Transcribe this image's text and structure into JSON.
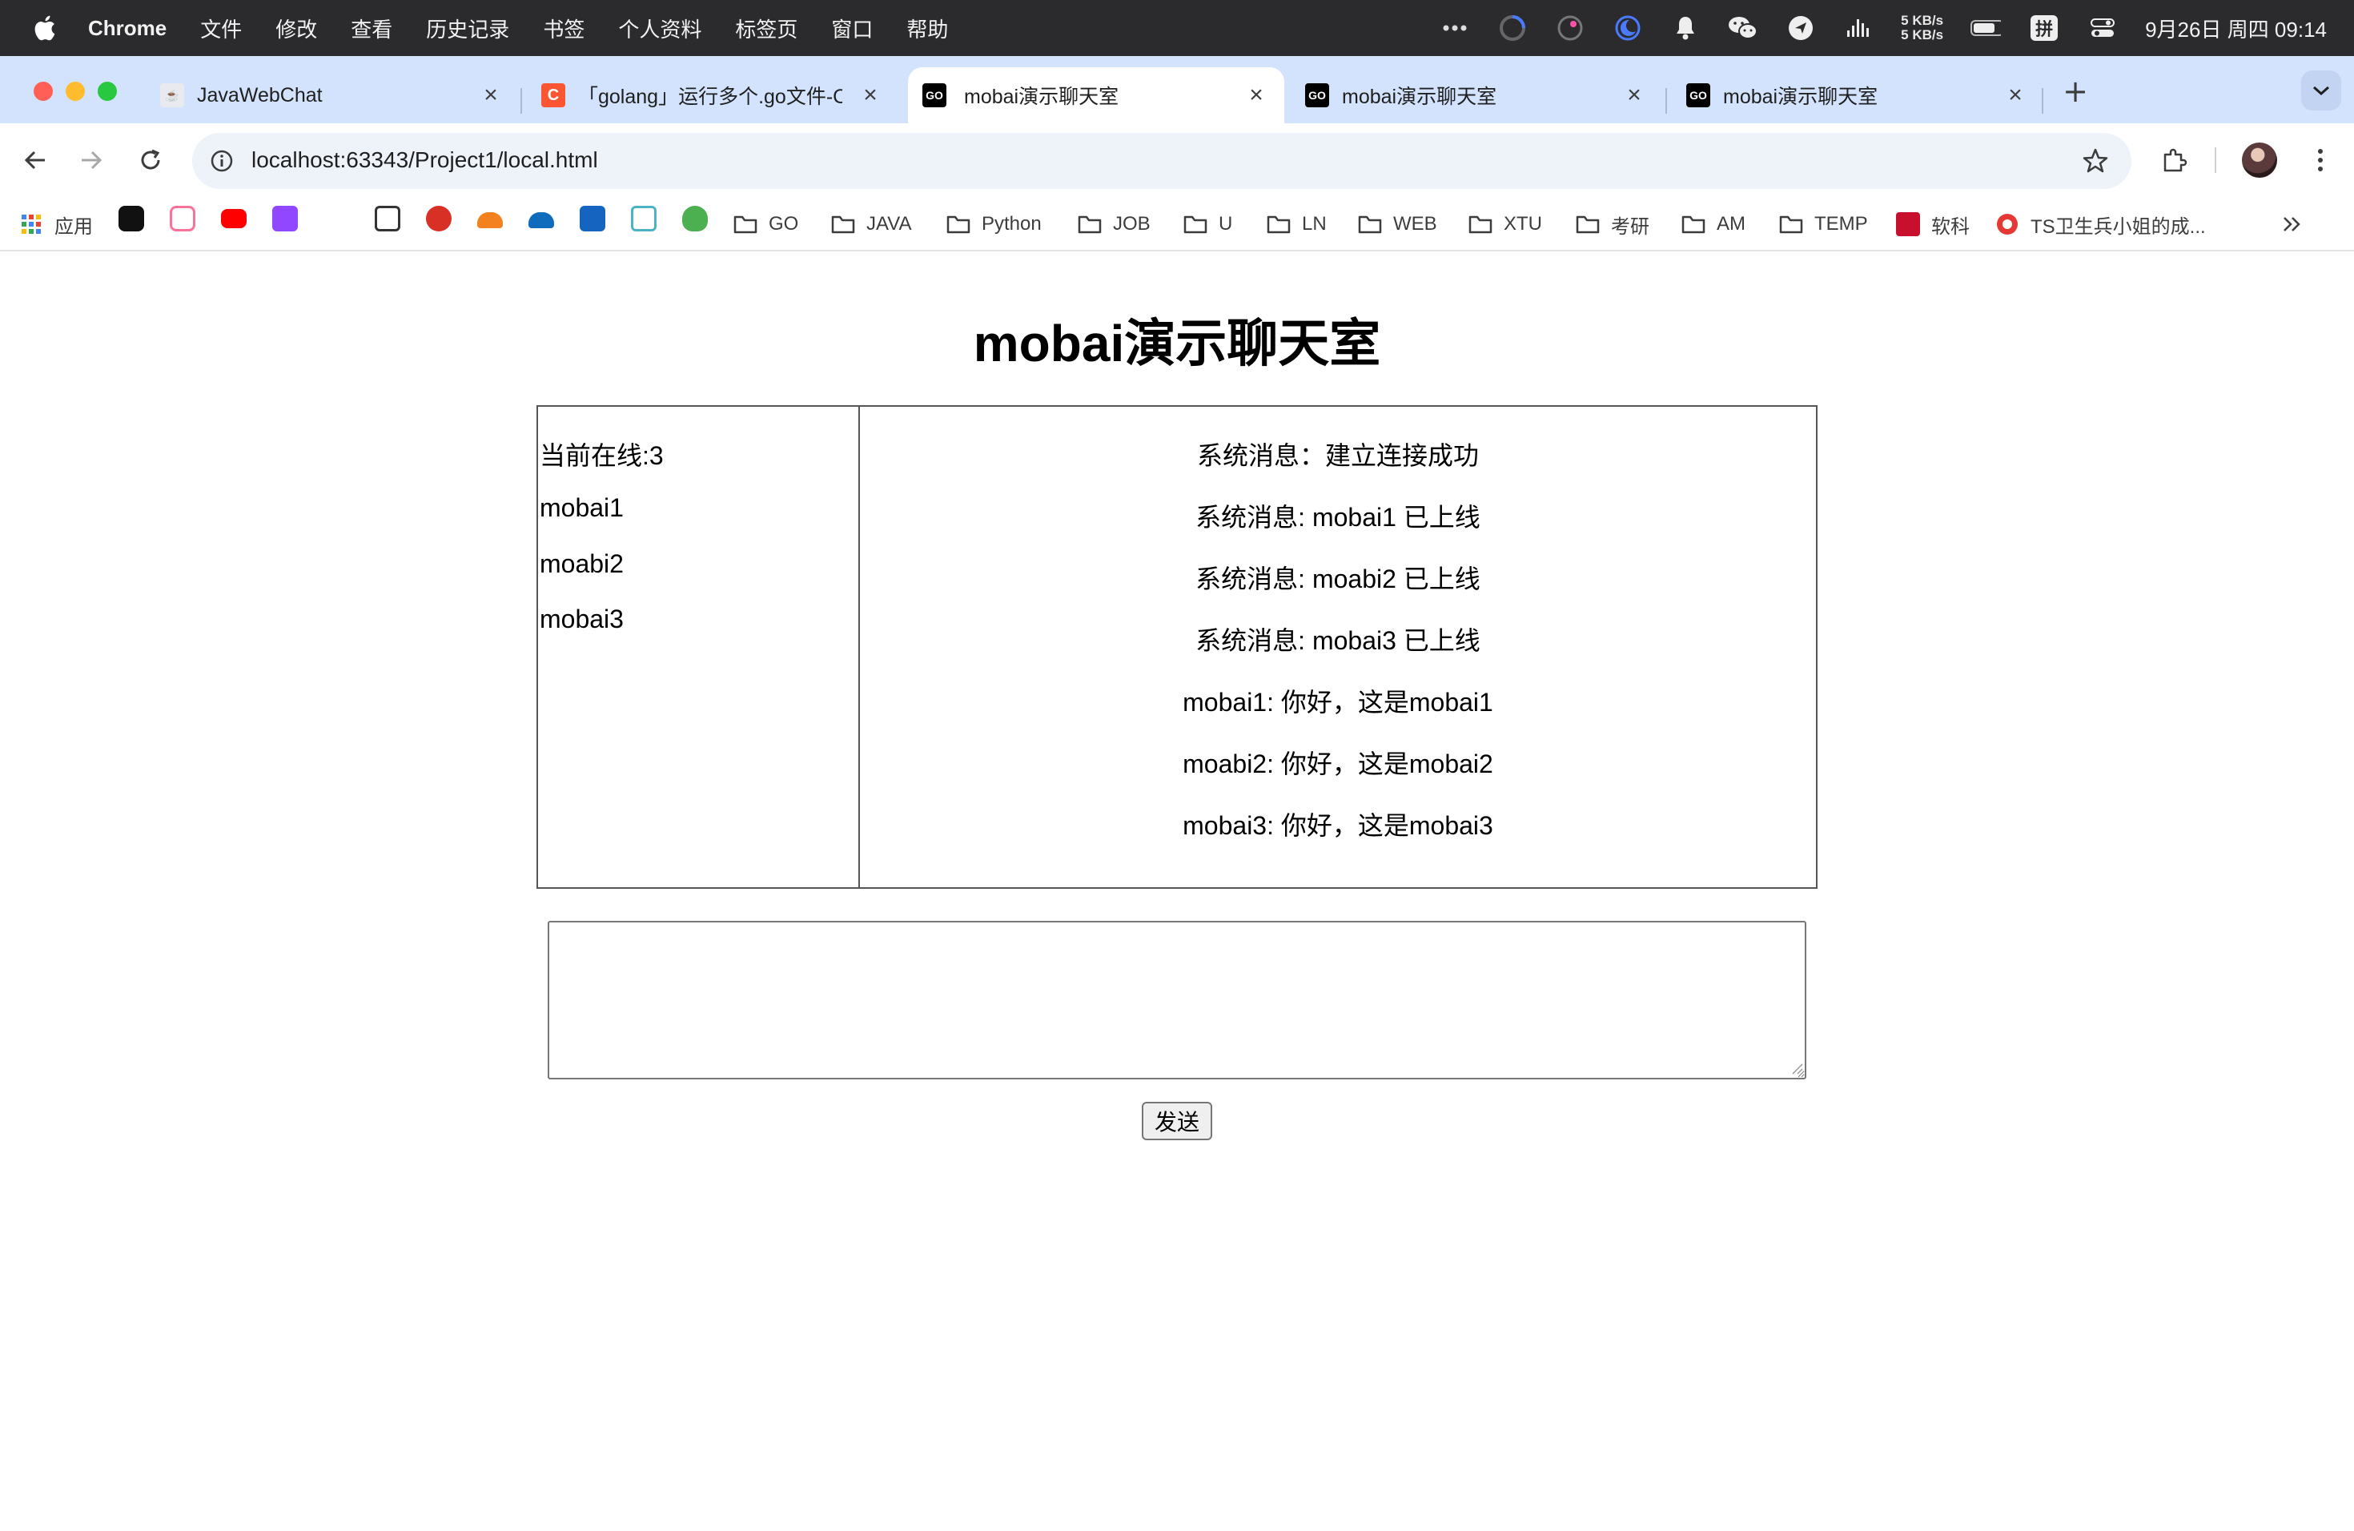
{
  "menubar": {
    "app_name": "Chrome",
    "items": [
      "文件",
      "修改",
      "查看",
      "历史记录",
      "书签",
      "个人资料",
      "标签页",
      "窗口",
      "帮助"
    ],
    "net_up": "5 KB/s",
    "net_down": "5 KB/s",
    "input_method": "拼",
    "clock": "9月26日 周四  09:14"
  },
  "tabs": [
    {
      "title": "JavaWebChat",
      "favicon": "javawebchat-favicon"
    },
    {
      "title": "「golang」运行多个.go文件-C",
      "favicon": "csdn-favicon"
    },
    {
      "title": "mobai演示聊天室",
      "favicon": "goland-favicon",
      "active": true
    },
    {
      "title": "mobai演示聊天室",
      "favicon": "goland-favicon"
    },
    {
      "title": "mobai演示聊天室",
      "favicon": "goland-favicon"
    }
  ],
  "address_bar": {
    "url": "localhost:63343/Project1/local.html"
  },
  "bookmarks": {
    "apps_label": "应用",
    "folders": [
      "GO",
      "JAVA",
      "Python",
      "JOB",
      "U",
      "LN",
      "WEB",
      "XTU",
      "考研",
      "AM",
      "TEMP"
    ],
    "links": [
      "软科",
      "TS卫生兵小姐的成..."
    ]
  },
  "page": {
    "title": "mobai演示聊天室",
    "online_label": "当前在线:3",
    "users": [
      "mobai1",
      "moabi2",
      "mobai3"
    ],
    "messages": [
      "系统消息：建立连接成功",
      "系统消息: mobai1 已上线",
      "系统消息: moabi2 已上线",
      "系统消息: mobai3 已上线",
      "mobai1: 你好，这是mobai1",
      "moabi2: 你好，这是mobai2",
      "mobai3: 你好，这是mobai3"
    ],
    "message_input_value": "",
    "send_label": "发送"
  },
  "colors": {
    "menubar_bg": "#2b2b2d",
    "tabstrip_bg": "#d3e3fd",
    "omnibox_bg": "#eef2f9",
    "traffic_red": "#ff5f57",
    "traffic_yellow": "#febc2e",
    "traffic_green": "#28c840"
  }
}
